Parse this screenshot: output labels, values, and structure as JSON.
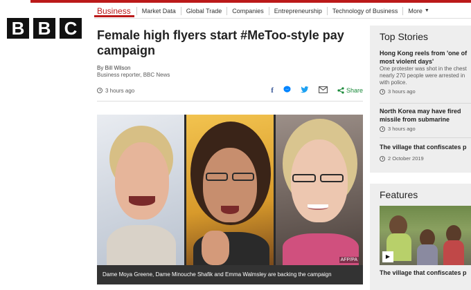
{
  "brand": {
    "logo_letters": [
      "B",
      "B",
      "C"
    ],
    "accent_color": "#bb1919"
  },
  "nav": {
    "section": "Business",
    "items": [
      "Market Data",
      "Global Trade",
      "Companies",
      "Entrepreneurship",
      "Technology of Business"
    ],
    "more_label": "More"
  },
  "article": {
    "headline": "Female high flyers start #MeToo-style pay campaign",
    "author": "By Bill Wilson",
    "author_role": "Business reporter, BBC News",
    "published": "3 hours ago",
    "share_label": "Share",
    "share_icons": [
      "facebook-icon",
      "messenger-icon",
      "twitter-icon",
      "email-icon",
      "share-icon"
    ],
    "image_credit": "AFP/PA",
    "image_caption": "Dame Moya Greene, Dame Minouche Shafik and Emma Walmsley are backing the campaign"
  },
  "top_stories": {
    "title": "Top Stories",
    "items": [
      {
        "title_lines": [
          "Hong Kong reels from 'one of",
          "most violent days'"
        ],
        "summary_lines": [
          "One protester was shot in the chest",
          "nearly 270 people were arrested in",
          "with police."
        ],
        "time": "3 hours ago"
      },
      {
        "title_lines": [
          "North Korea may have fired",
          "missile from submarine"
        ],
        "summary_lines": [],
        "time": "3 hours ago"
      },
      {
        "title_lines": [
          "The village that confiscates p"
        ],
        "summary_lines": [],
        "time": "2 October 2019"
      }
    ]
  },
  "features": {
    "title": "Features",
    "item_title": "The village that confiscates p",
    "play_icon": "play-icon"
  }
}
